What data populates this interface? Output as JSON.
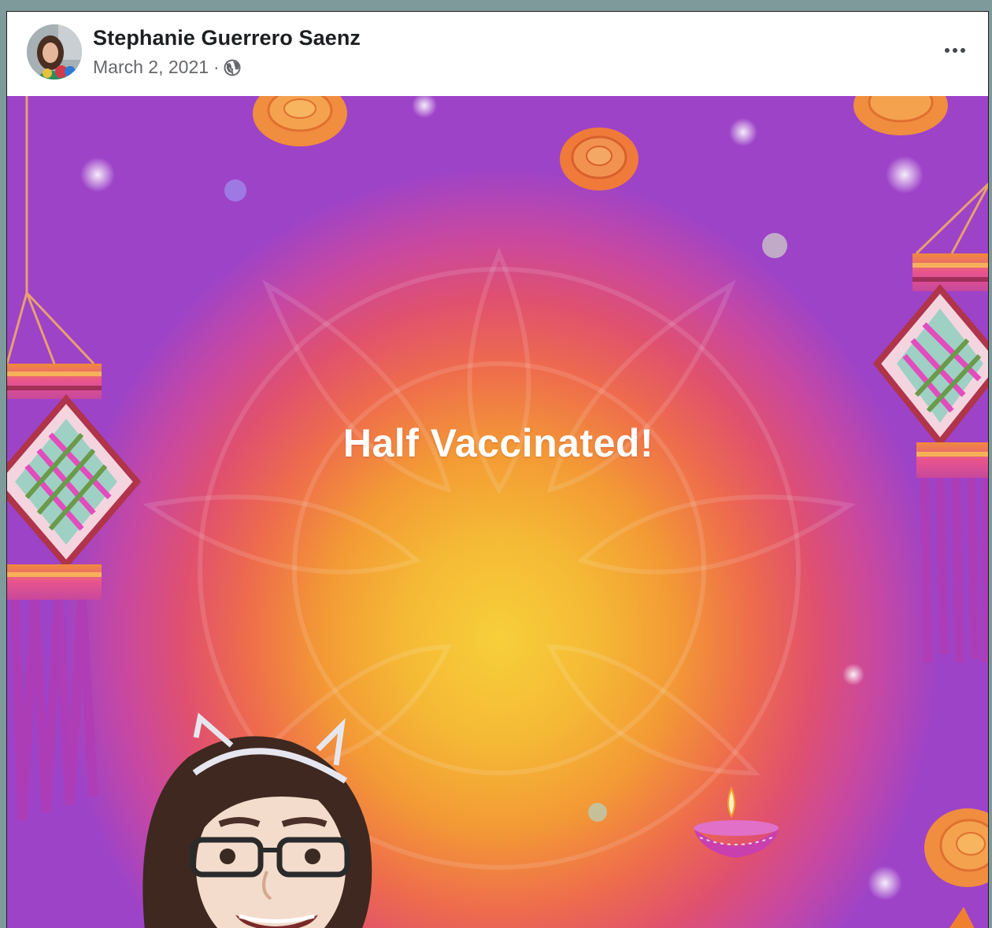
{
  "post": {
    "author_name": "Stephanie Guerrero Saenz",
    "date": "March 2, 2021",
    "separator": "·",
    "privacy_icon": "globe-icon",
    "menu_icon": "more-options-icon"
  },
  "media": {
    "headline": "Half Vaccinated!",
    "decorations": [
      "hanging-lantern",
      "marigold-flower",
      "diya-lamp",
      "avatar-character"
    ]
  },
  "colors": {
    "background_frame": "#7e9a9a",
    "name_text": "#1c1e21",
    "meta_text": "#65676b",
    "gradient_center": "#f7cf3a",
    "gradient_edge": "#9d43c8"
  }
}
